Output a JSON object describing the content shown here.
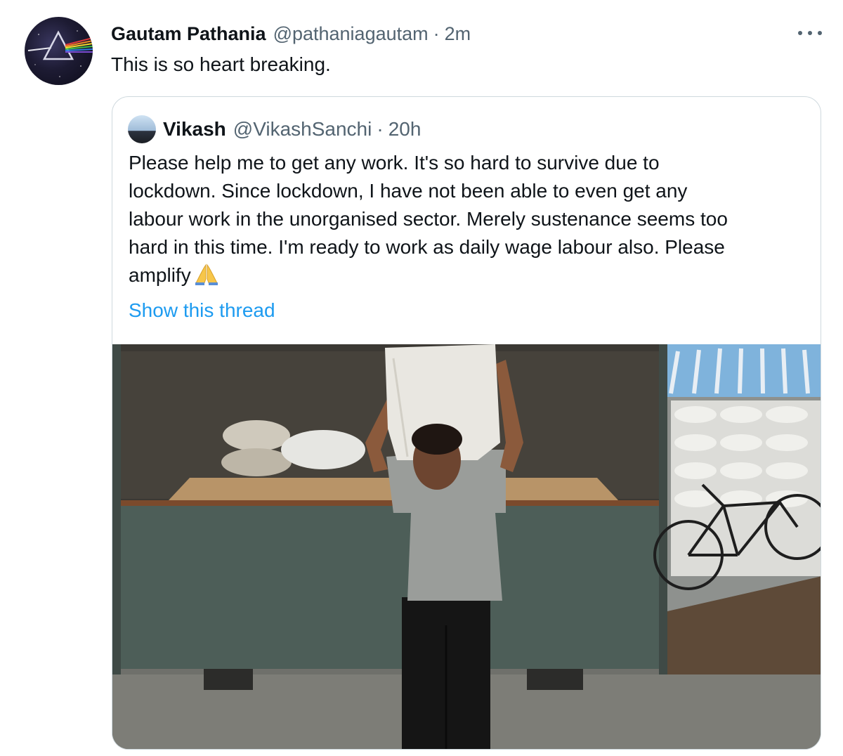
{
  "tweet": {
    "author_name": "Gautam Pathania",
    "author_handle": "@pathaniagautam",
    "separator": "·",
    "time": "2m",
    "text": "This is so heart breaking.",
    "avatar_icon": "pink-floyd-prism-avatar",
    "more_icon": "more-options-icon"
  },
  "quoted_tweet": {
    "author_name": "Vikash",
    "author_handle": "@VikashSanchi",
    "separator": "·",
    "time": "20h",
    "text_lines": [
      "Please help me to get any work. It's so hard to survive due to",
      "lockdown. Since lockdown, I have not been able to even get any",
      "labour work in the unorganised sector. Merely sustenance seems too",
      "hard in this time. I'm ready to work as daily wage labour also. Please",
      "amplify"
    ],
    "emoji_icon": "folded-hands-emoji",
    "show_thread": "Show this thread",
    "photo_icon": "man-carrying-sack-photo"
  },
  "colors": {
    "text_primary": "#0f1419",
    "text_secondary": "#536471",
    "link": "#1d9bf0",
    "border": "#cfd9de"
  }
}
